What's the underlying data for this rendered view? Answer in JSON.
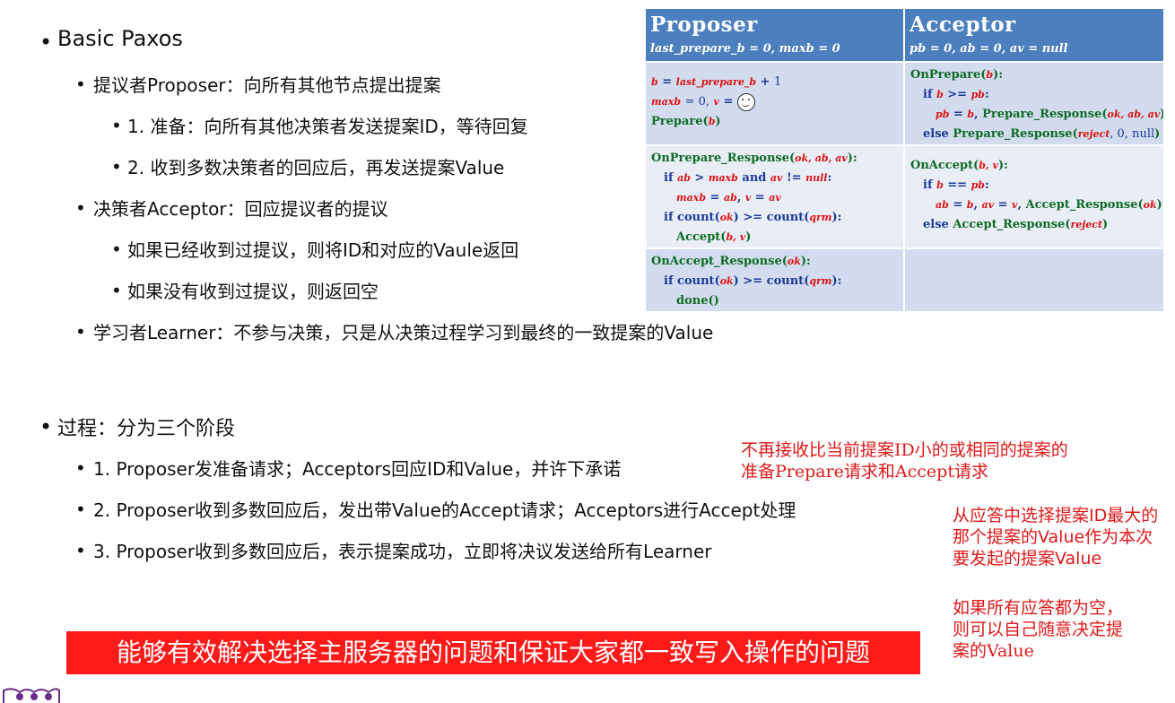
{
  "bullets": {
    "title": "Basic Paxos",
    "proposer": "提议者Proposer：向所有其他节点提出提案",
    "proposer_step1": "1. 准备：向所有其他决策者发送提案ID，等待回复",
    "proposer_step2": "2. 收到多数决策者的回应后，再发送提案Value",
    "acceptor": "决策者Acceptor：回应提议者的提议",
    "acceptor_case1": "如果已经收到过提议，则将ID和对应的Vaule返回",
    "acceptor_case2": "如果没有收到过提议，则返回空",
    "learner": "学习者Learner：不参与决策，只是从决策过程学习到最终的一致提案的Value",
    "process": "过程：分为三个阶段",
    "phase1": "1. Proposer发准备请求；Acceptors回应ID和Value，并许下承诺",
    "phase2": "2. Proposer收到多数回应后，发出带Value的Accept请求；Acceptors进行Accept处理",
    "phase3": "3. Proposer收到多数回应后，表示提案成功，立即将决议发送给所有Learner"
  },
  "table": {
    "proposer_header": "Proposer",
    "proposer_sub": "last_prepare_b = 0, maxb = 0",
    "acceptor_header": "Acceptor",
    "acceptor_sub": "pb = 0, ab = 0, av = null"
  },
  "notes": {
    "promise": "不再接收比当前提案ID小的或相同的提案的准备Prepare请求和Accept请求",
    "choose_value": "从应答中选择提案ID最大的那个提案的Value作为本次要发起的提案Value",
    "empty_case": "如果所有应答都为空，则可以自己随意决定提案的Value"
  },
  "banner": "能够有效解决选择主服务器的问题和保证大家都一致写入操作的问题",
  "colors": {
    "table_header": "#4c7fbd",
    "note_red": "#e01818",
    "banner_red": "#ff1a1a"
  }
}
